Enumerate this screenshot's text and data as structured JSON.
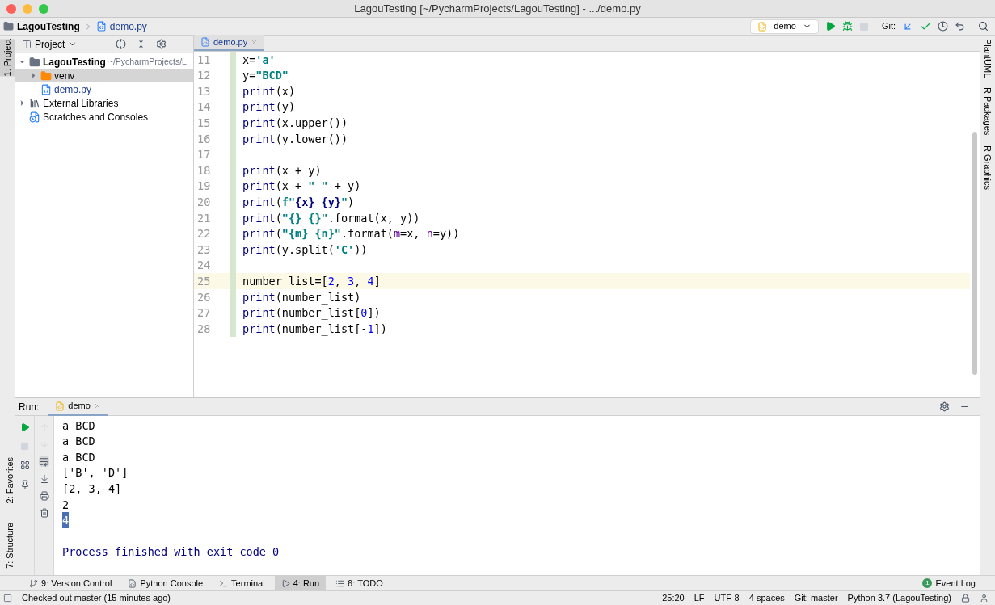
{
  "window": {
    "title": "LagouTesting [~/PycharmProjects/LagouTesting] - .../demo.py"
  },
  "navbar": {
    "breadcrumbs": [
      {
        "label": "LagouTesting",
        "kind": "folder"
      },
      {
        "label": "demo.py",
        "kind": "file"
      }
    ],
    "run_config": "demo",
    "git_label": "Git:"
  },
  "left_strip": [
    {
      "label": "1: Project",
      "selected": true
    }
  ],
  "left_strip_bottom": [
    {
      "label": "2: Favorites",
      "selected": false
    },
    {
      "label": "7: Structure",
      "selected": false
    }
  ],
  "right_strip": [
    "PlantUML",
    "R Packages",
    "R Graphics"
  ],
  "project": {
    "title": "Project",
    "tree": [
      {
        "label": "LagouTesting",
        "hint": "~/PycharmProjects/L",
        "kind": "folder",
        "expanded": true,
        "selected": false,
        "children": [
          {
            "label": "venv",
            "kind": "venv",
            "expanded": false,
            "selected": true
          },
          {
            "label": "demo.py",
            "kind": "file",
            "selected": false
          }
        ]
      },
      {
        "label": "External Libraries",
        "kind": "library",
        "expanded": false,
        "selected": false
      },
      {
        "label": "Scratches and Consoles",
        "kind": "scratch",
        "selected": false
      }
    ]
  },
  "editor": {
    "tabs": [
      {
        "label": "demo.py",
        "selected": true
      }
    ],
    "lines": [
      {
        "number": "11",
        "current": false,
        "tokens": [
          {
            "text": "x=",
            "kind": "plain"
          },
          {
            "text": "'a'",
            "kind": "string"
          }
        ]
      },
      {
        "number": "12",
        "current": false,
        "tokens": [
          {
            "text": "y=",
            "kind": "plain"
          },
          {
            "text": "\"BCD\"",
            "kind": "string"
          }
        ]
      },
      {
        "number": "13",
        "current": false,
        "tokens": [
          {
            "text": "print",
            "kind": "builtin"
          },
          {
            "text": "(x)",
            "kind": "plain"
          }
        ]
      },
      {
        "number": "14",
        "current": false,
        "tokens": [
          {
            "text": "print",
            "kind": "builtin"
          },
          {
            "text": "(y)",
            "kind": "plain"
          }
        ]
      },
      {
        "number": "15",
        "current": false,
        "tokens": [
          {
            "text": "print",
            "kind": "builtin"
          },
          {
            "text": "(x.upper())",
            "kind": "plain"
          }
        ]
      },
      {
        "number": "16",
        "current": false,
        "tokens": [
          {
            "text": "print",
            "kind": "builtin"
          },
          {
            "text": "(y.lower())",
            "kind": "plain"
          }
        ]
      },
      {
        "number": "17",
        "current": false
      },
      {
        "number": "18",
        "current": false,
        "tokens": [
          {
            "text": "print",
            "kind": "builtin"
          },
          {
            "text": "(x + y)",
            "kind": "plain"
          }
        ]
      },
      {
        "number": "19",
        "current": false,
        "tokens": [
          {
            "text": "print",
            "kind": "builtin"
          },
          {
            "text": "(x + ",
            "kind": "plain"
          },
          {
            "text": "\" \"",
            "kind": "string"
          },
          {
            "text": " + y)",
            "kind": "plain"
          }
        ]
      },
      {
        "number": "20",
        "current": false,
        "tokens": [
          {
            "text": "print",
            "kind": "builtin"
          },
          {
            "text": "(",
            "kind": "plain"
          },
          {
            "text": "f\"",
            "kind": "string"
          },
          {
            "text": "{x} {y}",
            "kind": "brace"
          },
          {
            "text": "\"",
            "kind": "string"
          },
          {
            "text": ")",
            "kind": "plain"
          }
        ]
      },
      {
        "number": "21",
        "current": false,
        "tokens": [
          {
            "text": "print",
            "kind": "builtin"
          },
          {
            "text": "(",
            "kind": "plain"
          },
          {
            "text": "\"{} {}\"",
            "kind": "string"
          },
          {
            "text": ".format(x, y))",
            "kind": "plain"
          }
        ]
      },
      {
        "number": "22",
        "current": false,
        "tokens": [
          {
            "text": "print",
            "kind": "builtin"
          },
          {
            "text": "(",
            "kind": "plain"
          },
          {
            "text": "\"{m} {n}\"",
            "kind": "string"
          },
          {
            "text": ".format(",
            "kind": "plain"
          },
          {
            "text": "m",
            "kind": "param"
          },
          {
            "text": "=x, ",
            "kind": "plain"
          },
          {
            "text": "n",
            "kind": "param"
          },
          {
            "text": "=y))",
            "kind": "plain"
          }
        ]
      },
      {
        "number": "23",
        "current": false,
        "tokens": [
          {
            "text": "print",
            "kind": "builtin"
          },
          {
            "text": "(y.split(",
            "kind": "plain"
          },
          {
            "text": "'C'",
            "kind": "string"
          },
          {
            "text": "))",
            "kind": "plain"
          }
        ]
      },
      {
        "number": "24",
        "current": false
      },
      {
        "number": "25",
        "current": true,
        "tokens": [
          {
            "text": "number_list=[",
            "kind": "plain"
          },
          {
            "text": "2",
            "kind": "number"
          },
          {
            "text": ", ",
            "kind": "plain"
          },
          {
            "text": "3",
            "kind": "number"
          },
          {
            "text": ", ",
            "kind": "plain"
          },
          {
            "text": "4",
            "kind": "number"
          },
          {
            "text": "]",
            "kind": "plain"
          }
        ]
      },
      {
        "number": "26",
        "current": false,
        "tokens": [
          {
            "text": "print",
            "kind": "builtin"
          },
          {
            "text": "(number_list)",
            "kind": "plain"
          }
        ]
      },
      {
        "number": "27",
        "current": false,
        "tokens": [
          {
            "text": "print",
            "kind": "builtin"
          },
          {
            "text": "(number_list[",
            "kind": "plain"
          },
          {
            "text": "0",
            "kind": "number"
          },
          {
            "text": "])",
            "kind": "plain"
          }
        ]
      },
      {
        "number": "28",
        "current": false,
        "tokens": [
          {
            "text": "print",
            "kind": "builtin"
          },
          {
            "text": "(number_list[-",
            "kind": "plain"
          },
          {
            "text": "1",
            "kind": "number"
          },
          {
            "text": "])",
            "kind": "plain"
          }
        ]
      }
    ]
  },
  "run": {
    "label": "Run:",
    "tabs": [
      {
        "label": "demo",
        "selected": true
      }
    ],
    "output": [
      {
        "text": "a BCD",
        "kind": "output",
        "selected": false
      },
      {
        "text": "a BCD",
        "kind": "output",
        "selected": false
      },
      {
        "text": "a BCD",
        "kind": "output",
        "selected": false
      },
      {
        "text": "['B', 'D']",
        "kind": "output",
        "selected": false
      },
      {
        "text": "[2, 3, 4]",
        "kind": "output",
        "selected": false
      },
      {
        "text": "2",
        "kind": "output",
        "selected": false
      },
      {
        "text": "4",
        "kind": "output",
        "selected": true
      },
      {
        "kind": "blank",
        "selected": false
      },
      {
        "text": "Process finished with exit code 0",
        "kind": "exit",
        "selected": false
      }
    ]
  },
  "tool_windows": [
    {
      "label": "9: Version Control",
      "kind": "vcs",
      "selected": false
    },
    {
      "label": "Python Console",
      "kind": "python",
      "selected": false
    },
    {
      "label": "Terminal",
      "kind": "terminal",
      "selected": false
    },
    {
      "label": "4: Run",
      "kind": "run",
      "selected": true
    },
    {
      "label": "6: TODO",
      "kind": "todo",
      "selected": false
    }
  ],
  "event_log": {
    "label": "Event Log",
    "count": "1"
  },
  "status_bar": {
    "message": "Checked out master (15 minutes ago)",
    "items": [
      "25:20",
      "LF",
      "UTF-8",
      "4 spaces",
      "Git: master",
      "Python 3.7 (LagouTesting)"
    ]
  }
}
